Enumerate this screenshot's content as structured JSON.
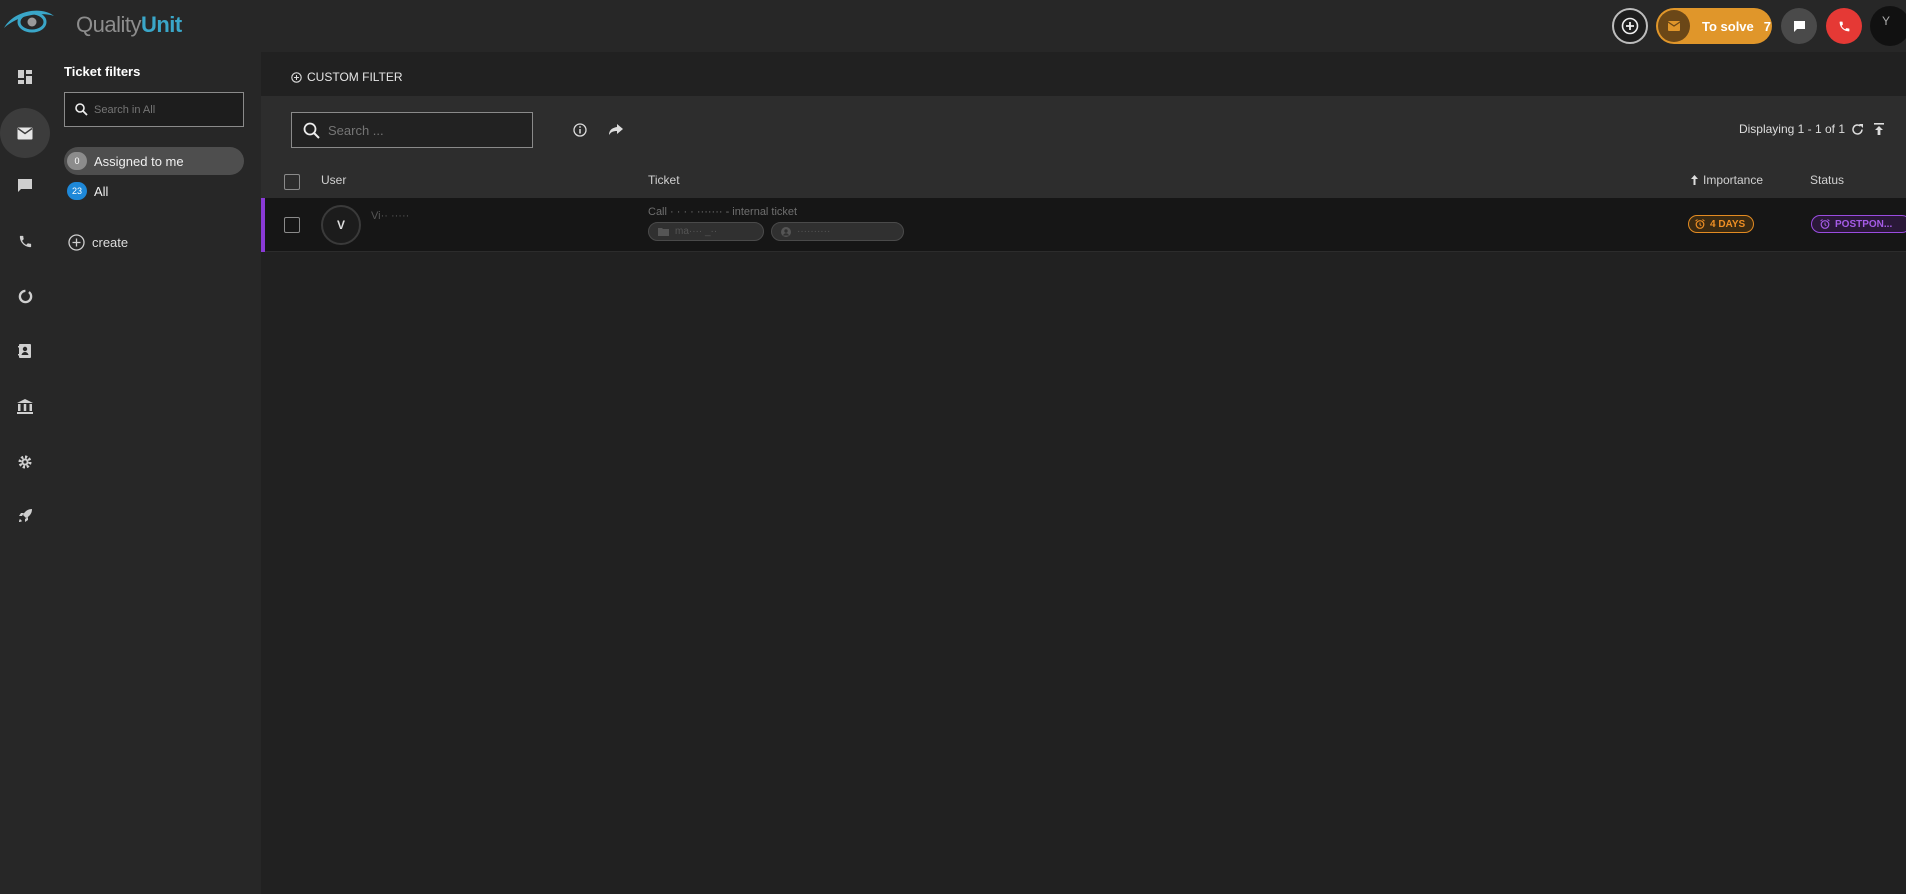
{
  "app": {
    "logo_word1": "Quality",
    "logo_word2": "Unit"
  },
  "header": {
    "to_solve_label": "To solve",
    "to_solve_count": "7",
    "avatar_initial": "Y"
  },
  "sidebar": {
    "icons": [
      "dashboard-icon",
      "mail-icon",
      "chat-icon",
      "phone-icon",
      "reports-icon",
      "contacts-icon",
      "company-icon",
      "settings-icon",
      "rocket-icon"
    ]
  },
  "filters": {
    "title": "Ticket filters",
    "search_placeholder": "Search in All",
    "items": [
      {
        "label": "Assigned to me",
        "count": "0"
      },
      {
        "label": "All",
        "count": "23"
      }
    ],
    "create_label": "create"
  },
  "main": {
    "custom_filter_label": "CUSTOM FILTER",
    "search_placeholder": "Search ...",
    "displaying": "Displaying 1 - 1 of 1",
    "columns": {
      "user": "User",
      "ticket": "Ticket",
      "importance": "Importance",
      "status": "Status"
    },
    "rows": [
      {
        "user_initial": "V",
        "user_name": "Vi·· ·····",
        "subject": "Call · · · · ······· - internal ticket",
        "tag1": "ma···· _··",
        "tag2": "··········",
        "importance": "4 DAYS",
        "status": "POSTPON..."
      }
    ]
  },
  "colors": {
    "accent_orange": "#e0962a",
    "call_red": "#e53935",
    "stripe_purple": "#8a3ad6",
    "status_purple": "#a65ce8",
    "brand_blue": "#3aa6c8"
  }
}
